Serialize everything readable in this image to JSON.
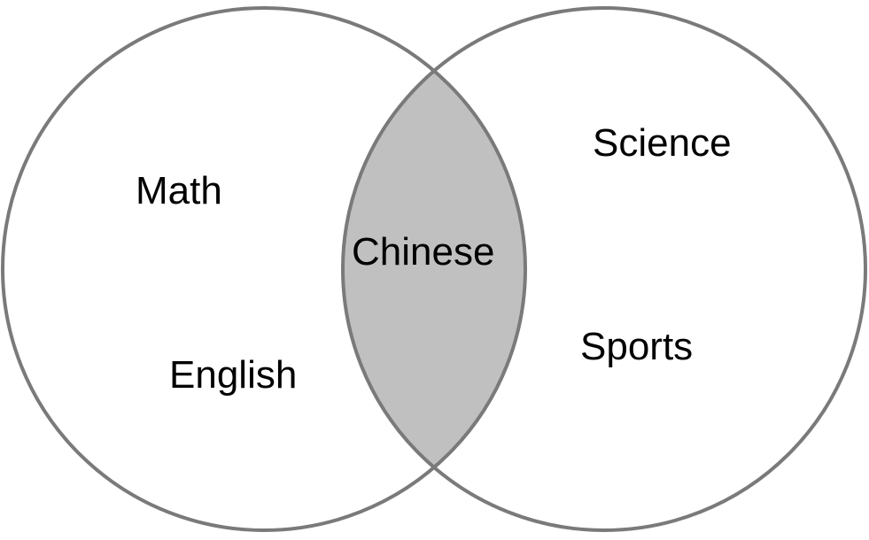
{
  "diagram": {
    "type": "venn",
    "left_set": {
      "items": [
        "Math",
        "English"
      ]
    },
    "right_set": {
      "items": [
        "Science",
        "Sports"
      ]
    },
    "intersection": {
      "items": [
        "Chinese"
      ]
    },
    "colors": {
      "outline": "#7a7a7a",
      "intersection_fill": "#c0c0c0",
      "text": "#000000",
      "background": "#ffffff"
    }
  }
}
